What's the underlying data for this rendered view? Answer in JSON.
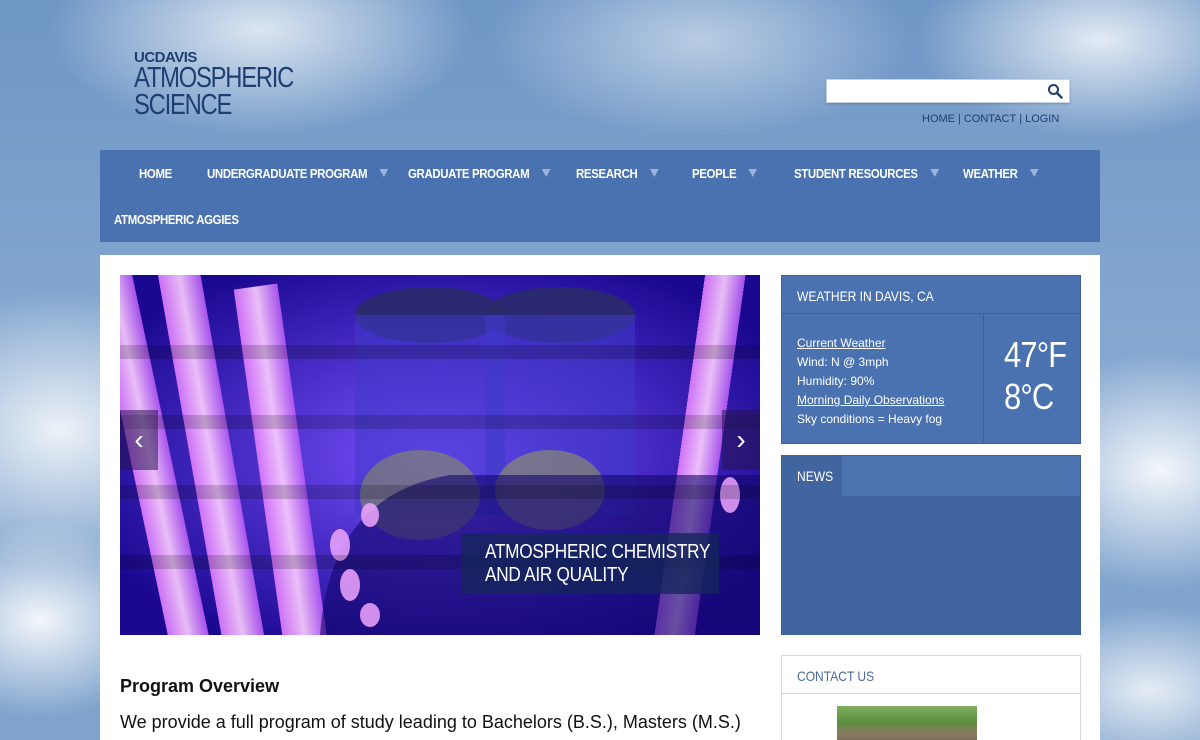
{
  "logo": {
    "uc": "UC",
    "davis": "DAVIS",
    "line1": "ATMOSPHERIC",
    "line2": "SCIENCE"
  },
  "search": {
    "placeholder": "",
    "icon": "search-icon"
  },
  "utility_links": [
    "HOME",
    "CONTACT",
    "LOGIN"
  ],
  "nav": {
    "items": [
      {
        "label": "HOME",
        "has_dropdown": false
      },
      {
        "label": "UNDERGRADUATE PROGRAM",
        "has_dropdown": true
      },
      {
        "label": "GRADUATE PROGRAM",
        "has_dropdown": true
      },
      {
        "label": "RESEARCH",
        "has_dropdown": true
      },
      {
        "label": "PEOPLE",
        "has_dropdown": true
      },
      {
        "label": "STUDENT RESOURCES",
        "has_dropdown": true
      },
      {
        "label": "WEATHER",
        "has_dropdown": true
      },
      {
        "label": "ATMOSPHERIC AGGIES",
        "has_dropdown": false
      }
    ]
  },
  "slider": {
    "prev": "‹",
    "next": "›",
    "caption_line1": "ATMOSPHERIC CHEMISTRY",
    "caption_line2": "AND AIR QUALITY"
  },
  "overview": {
    "title": "Program Overview",
    "text": "We provide a full program of study leading to Bachelors (B.S.), Masters (M.S.)"
  },
  "weather": {
    "title": "WEATHER IN DAVIS, CA",
    "current_link": "Current Weather",
    "wind": "Wind: N @ 3mph",
    "humidity": "Humidity: 90%",
    "observations_link": "Morning Daily Observations",
    "sky": "Sky conditions = Heavy fog",
    "temp_f": "47°F",
    "temp_c": "8°C"
  },
  "news": {
    "tab": "NEWS"
  },
  "contact": {
    "title": "CONTACT US"
  },
  "colors": {
    "nav": "#4a72b0",
    "brand": "#1f3f72",
    "widget": "#4a72b0"
  }
}
